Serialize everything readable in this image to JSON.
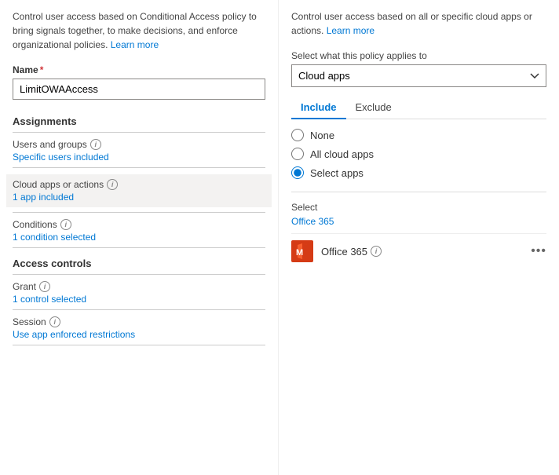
{
  "left": {
    "description": "Control user access based on Conditional Access policy to bring signals together, to make decisions, and enforce organizational policies.",
    "learn_more_left": "Learn more",
    "name_label": "Name",
    "name_value": "LimitOWAAccess",
    "assignments_label": "Assignments",
    "users_groups_label": "Users and groups",
    "users_groups_value": "Specific users included",
    "cloud_apps_label": "Cloud apps or actions",
    "cloud_apps_value": "1 app included",
    "conditions_label": "Conditions",
    "conditions_value": "1 condition selected",
    "access_controls_label": "Access controls",
    "grant_label": "Grant",
    "grant_value": "1 control selected",
    "session_label": "Session",
    "session_value": "Use app enforced restrictions"
  },
  "right": {
    "description": "Control user access based on all or specific cloud apps or actions.",
    "learn_more_right": "Learn more",
    "dropdown_label": "Select what this policy applies to",
    "dropdown_value": "Cloud apps",
    "tab_include": "Include",
    "tab_exclude": "Exclude",
    "radio_none": "None",
    "radio_all": "All cloud apps",
    "radio_select": "Select apps",
    "select_label": "Select",
    "select_link": "Office 365",
    "app_name": "Office 365",
    "more_icon": "•••"
  }
}
